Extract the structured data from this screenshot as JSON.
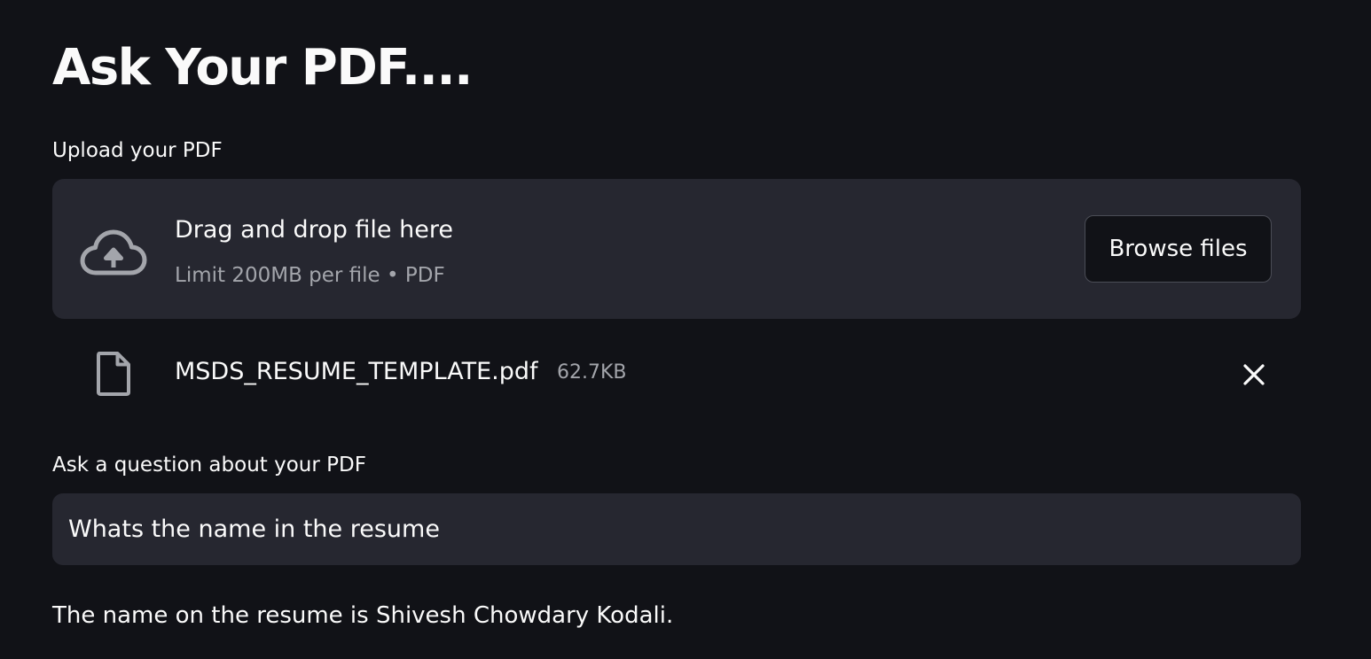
{
  "page": {
    "title": "Ask Your PDF...."
  },
  "uploader": {
    "label": "Upload your PDF",
    "dropzone_title": "Drag and drop file here",
    "dropzone_limit": "Limit 200MB per file • PDF",
    "browse_label": "Browse files",
    "upload_icon": "cloud-upload-icon"
  },
  "uploaded_file": {
    "name": "MSDS_RESUME_TEMPLATE.pdf",
    "size": "62.7KB",
    "file_icon": "file-icon",
    "remove_icon": "close-icon"
  },
  "question": {
    "label": "Ask a question about your PDF",
    "value": "Whats the name in the resume"
  },
  "answer": {
    "text": "The name on the resume is Shivesh Chowdary Kodali."
  },
  "colors": {
    "background": "#111217",
    "panel": "#262730",
    "text": "#fafafa",
    "muted_text": "#a3a5ab",
    "border": "#4b4d56"
  }
}
